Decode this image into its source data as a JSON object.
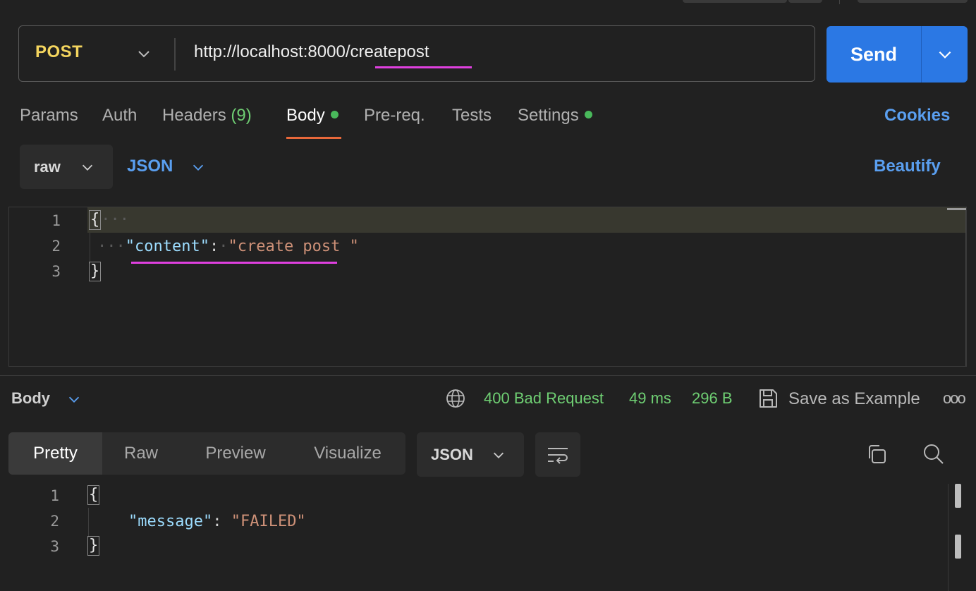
{
  "request": {
    "method": "POST",
    "url": "http://localhost:8000/createpost",
    "send_label": "Send"
  },
  "request_tabs": [
    {
      "label": "Params"
    },
    {
      "label": "Auth"
    },
    {
      "label": "Headers",
      "count": "(9)"
    },
    {
      "label": "Body",
      "active": true,
      "dot": true
    },
    {
      "label": "Pre-req."
    },
    {
      "label": "Tests"
    },
    {
      "label": "Settings",
      "dot": true
    }
  ],
  "cookies_label": "Cookies",
  "body_options": {
    "mode": "raw",
    "language": "JSON",
    "beautify_label": "Beautify"
  },
  "request_body": {
    "line_numbers": [
      "1",
      "2",
      "3"
    ],
    "open_brace": "{",
    "close_brace": "}",
    "key": "\"content\"",
    "colon": ":",
    "value": "\"create post \""
  },
  "response": {
    "section_label": "Body",
    "status": "400 Bad Request",
    "time": "49 ms",
    "size": "296 B",
    "save_label": "Save as Example",
    "more_label": "ooo",
    "view_tabs": [
      "Pretty",
      "Raw",
      "Preview",
      "Visualize"
    ],
    "format": "JSON",
    "line_numbers": [
      "1",
      "2",
      "3"
    ],
    "open_brace": "{",
    "close_brace": "}",
    "key": "\"message\"",
    "colon": ":",
    "value": "\"FAILED\""
  },
  "colors": {
    "accent_blue": "#2b78e4",
    "method_yellow": "#f4d55e",
    "status_green": "#6fcf73",
    "active_underline": "#e8683a",
    "annotation_magenta": "#e040e0"
  }
}
